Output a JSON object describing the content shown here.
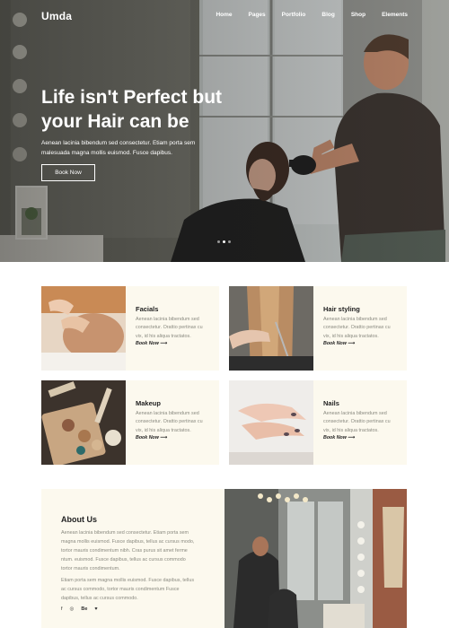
{
  "nav": {
    "brand": "Umda",
    "links": [
      "Home",
      "Pages",
      "Portfolio",
      "Blog",
      "Shop",
      "Elements"
    ]
  },
  "hero": {
    "title_line1": "Life isn't Perfect but",
    "title_line2": "your Hair can be",
    "text_line1": "Aenean lacinia bibendum sed consectetur. Etiam porta sem",
    "text_line2": "malesuada magna mollis euismod. Fusce dapibus.",
    "button": "Book Now",
    "slide_count": 3,
    "active_slide": 2
  },
  "services": [
    {
      "title": "Facials",
      "text": [
        "Aenean lacinia bibendum sed",
        "consectetur. Orattio pertinax cu",
        "vix, id his aliqua tractatos."
      ],
      "link": "Book Now"
    },
    {
      "title": "Hair styling",
      "text": [
        "Aenean lacinia bibendum sed",
        "consectetur. Orattio pertinax cu",
        "vix, id his aliqua tractatos."
      ],
      "link": "Book Now"
    },
    {
      "title": "Makeup",
      "text": [
        "Aenean lacinia bibendum sed",
        "consectetur. Orattio pertinax cu",
        "vix, id his aliqua tractatos."
      ],
      "link": "Book Now"
    },
    {
      "title": "Nails",
      "text": [
        "Aenean lacinia bibendum sed",
        "consectetur. Orattio pertinax cu",
        "vix, id his aliqua tractatos."
      ],
      "link": "Book Now"
    }
  ],
  "about": {
    "title": "About Us",
    "para1": [
      "Aenean lacinia bibendum sed consectetur. Etiam porta sem",
      "magna mollis euismod. Fusce dapibus, tellus ac cursus modo,",
      "tortor mauris condimentum nibh. Cras purus sit amet ferme",
      "ntum. euismod. Fusce dapibus, tellus ac cursus commodo",
      "tortor mauris condimentum."
    ],
    "para2": [
      "Etiam porta sem magna mollis euismod. Fusce dapibus, tellus",
      "ac cursus commodo, tortor mauris condimentum Fusce",
      "dapibus, tellus ac cursus commodo."
    ],
    "social": [
      "f",
      "◎",
      "Be",
      "♥"
    ]
  },
  "colors": {
    "card_bg": "#fcf9ee",
    "muted_text": "#8a8a80",
    "white": "#ffffff"
  }
}
